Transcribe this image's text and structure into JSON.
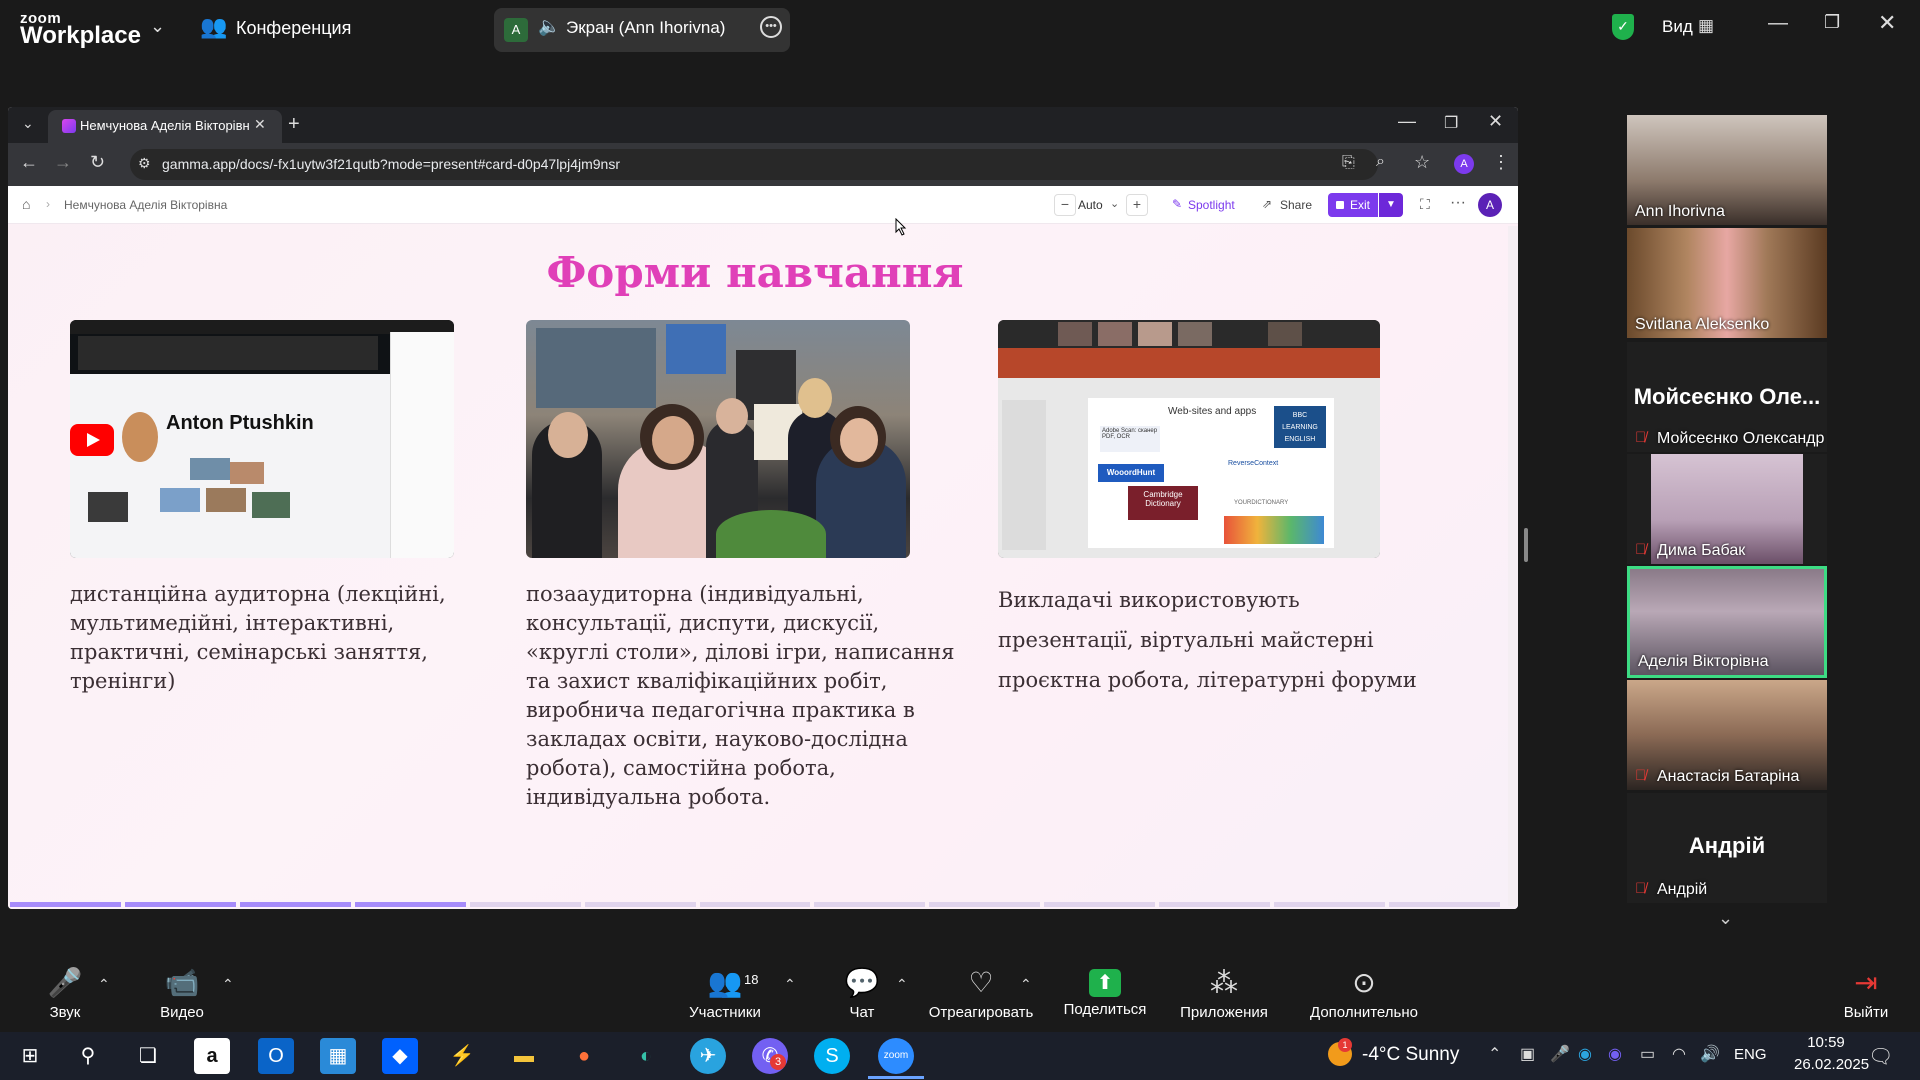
{
  "zoom": {
    "brand_small": "zoom",
    "brand_big": "Workplace",
    "meeting_label": "Конференция",
    "share_avatar": "A",
    "share_label": "Экран (Ann Ihorivna)",
    "view_label": "Вид"
  },
  "browser": {
    "tab_title": "Немчунова Аделія Вікторівна",
    "url": "gamma.app/docs/-fx1uytw3f21qutb?mode=present#card-d0p47lpj4jm9nsr",
    "profile_initial": "A"
  },
  "gamma": {
    "breadcrumb": "Немчунова Аделія Вікторівна",
    "zoom_mode": "Auto",
    "spotlight_label": "Spotlight",
    "share_label": "Share",
    "exit_label": "Exit",
    "avatar_initial": "A",
    "progress": {
      "total_segments": 13,
      "current": 4
    }
  },
  "slide": {
    "title": "Форми навчання",
    "columns": [
      {
        "text": "дистанційна аудиторна (лекційні, мультимедійні, інтерактивні, практичні, семінарські заняття, тренінги)"
      },
      {
        "text": " позааудиторна (індивідуальні, консультації, диспути, дискусії, «круглі столи», ділові ігри, написання та захист кваліфікаційних робіт, виробнича педагогічна практика в закладах освіти, науково-дослідна робота), самостійна робота, індивідуальна робота."
      },
      {
        "text": "Викладачі використовують презентації, віртуальні майстерні проєктна робота, літературні форуми"
      }
    ],
    "image1": {
      "heading": "Anton Ptushkin"
    },
    "image3": {
      "heading": "Web-sites and apps",
      "items": [
        "Adobe Scan: сканер PDF, OCR",
        "BBC LEARNING ENGLISH",
        "WooordHunt",
        "Cambridge Dictionary",
        "ReverseContext",
        "YOURDICTIONARY"
      ]
    }
  },
  "participants": [
    {
      "name": "Ann Ihorivna",
      "muted": false,
      "video": true
    },
    {
      "name": "Svitlana Aleksenko",
      "muted": false,
      "video": true
    },
    {
      "name": "Мойсеєнко Олександр",
      "display": "Мойсеєнко Оле...",
      "muted": true,
      "video": false
    },
    {
      "name": "Дима Бабак",
      "muted": true,
      "video": true
    },
    {
      "name": "Аделія Вікторівна",
      "muted": false,
      "video": true,
      "active_speaker": true
    },
    {
      "name": "Анастасія Батаріна",
      "muted": true,
      "video": true
    },
    {
      "name": "Андрій",
      "display": "Андрій",
      "muted": true,
      "video": false
    }
  ],
  "toolbar": {
    "audio": "Звук",
    "video": "Видео",
    "participants": "Участники",
    "participants_count": "18",
    "chat": "Чат",
    "react": "Отреагировать",
    "share": "Поделиться",
    "apps": "Приложения",
    "more": "Дополнительно",
    "leave": "Выйти"
  },
  "taskbar": {
    "weather": "-4°C  Sunny",
    "viber_badge": "3",
    "weather_badge": "1",
    "lang": "ENG",
    "time": "10:59",
    "date": "26.02.2025"
  },
  "colors": {
    "accent": "#7c3aed",
    "title": "#e040b8",
    "active_speaker": "#3ddc84",
    "share_green": "#1fb14c"
  }
}
